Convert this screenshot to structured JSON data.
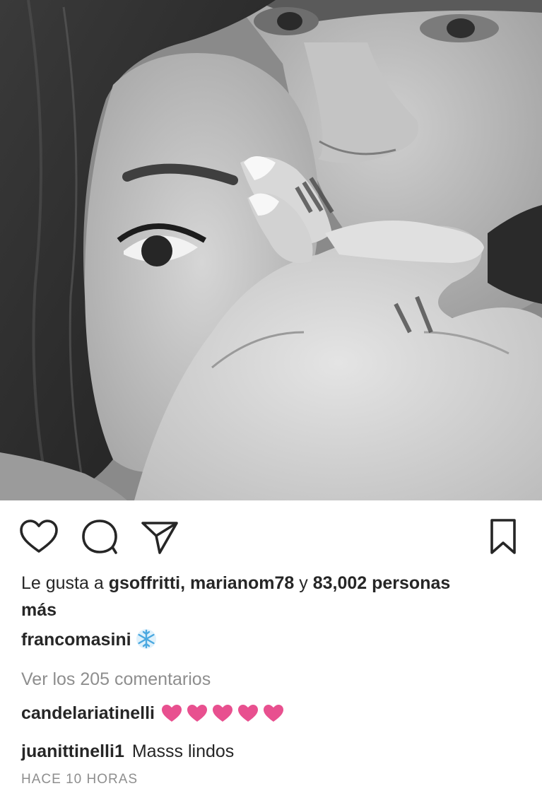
{
  "post": {
    "image_alt": "Black and white close-up photo of a couple",
    "likes": {
      "prefix": "Le gusta a",
      "user1": "gsoffritti,",
      "user2": "marianom78",
      "joiner": "y",
      "count_text": "83,002 personas",
      "suffix": "más"
    },
    "caption": {
      "username": "francomasini",
      "emoji_icon": "snowflake-icon"
    },
    "view_comments": "Ver los 205 comentarios",
    "comments": [
      {
        "username": "candelariatinelli",
        "text": "",
        "hearts": 5,
        "heart_color": "#e8508f"
      },
      {
        "username": "juanittinelli1",
        "text": "Masss lindos"
      }
    ],
    "timestamp": "HACE 10 HORAS"
  },
  "actions": {
    "like_icon": "heart-outline-icon",
    "comment_icon": "comment-bubble-icon",
    "share_icon": "paper-plane-icon",
    "save_icon": "bookmark-icon"
  },
  "colors": {
    "text": "#262626",
    "muted": "#8e8e8e",
    "heart": "#e8508f",
    "snowflake": "#4aa8e0"
  }
}
